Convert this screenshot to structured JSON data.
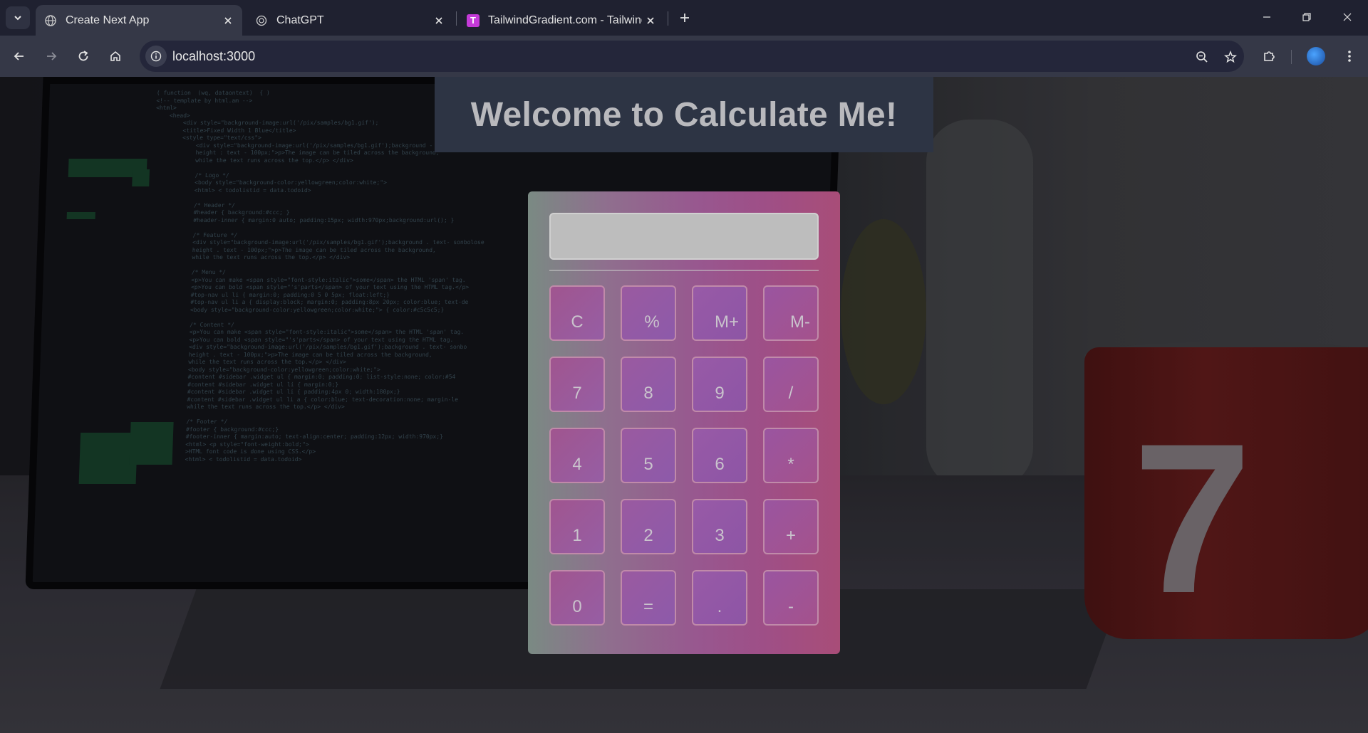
{
  "browser": {
    "tabs": [
      {
        "title": "Create Next App",
        "icon": "globe-icon",
        "active": true
      },
      {
        "title": "ChatGPT",
        "icon": "chatgpt-icon",
        "active": false
      },
      {
        "title": "TailwindGradient.com - Tailwind",
        "icon": "tailwindgradient-icon",
        "favicon_letter": "T",
        "active": false
      }
    ],
    "url": "localhost:3000"
  },
  "page": {
    "heading": "Welcome to Calculate Me!"
  },
  "calculator": {
    "display_value": "",
    "buttons": [
      [
        "C",
        "%",
        "M+",
        "M-"
      ],
      [
        "7",
        "8",
        "9",
        "/"
      ],
      [
        "4",
        "5",
        "6",
        "*"
      ],
      [
        "1",
        "2",
        "3",
        "+"
      ],
      [
        "0",
        "=",
        ".",
        "-"
      ]
    ]
  },
  "background_decor": {
    "cup_number": "7"
  }
}
